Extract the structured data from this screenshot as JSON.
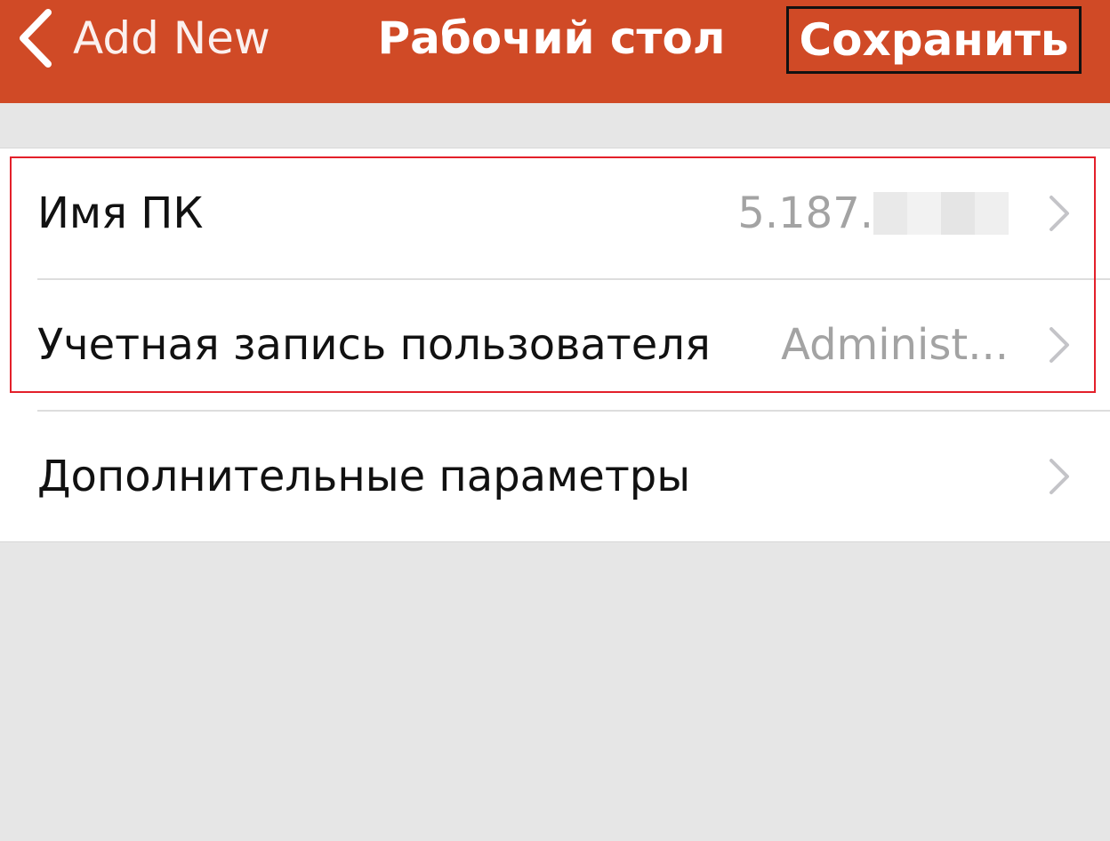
{
  "navbar": {
    "back_label": "Add New",
    "title": "Рабочий стол",
    "save_label": "Сохранить",
    "back_icon": "chevron-left-icon",
    "bar_color": "#d04a26"
  },
  "rows": [
    {
      "label": "Имя ПК",
      "value": "5.187.",
      "value_redacted": true,
      "icon": "chevron-right-icon"
    },
    {
      "label": "Учетная запись пользователя",
      "value": "Administ...",
      "icon": "chevron-right-icon"
    },
    {
      "label": "Дополнительные параметры",
      "value": "",
      "icon": "chevron-right-icon"
    }
  ],
  "highlight_color": "#e3202a"
}
